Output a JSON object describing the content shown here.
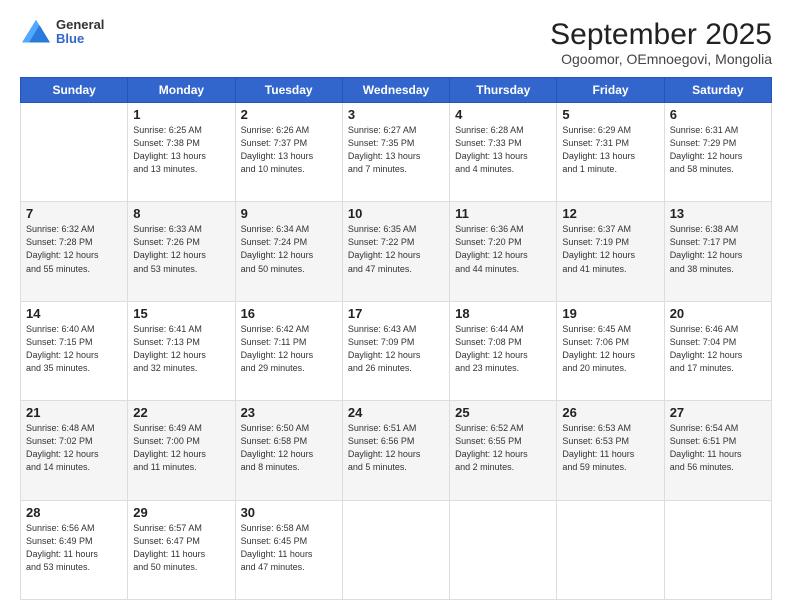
{
  "logo": {
    "general": "General",
    "blue": "Blue"
  },
  "title": {
    "month": "September 2025",
    "location": "Ogoomor, OEmnoegovi, Mongolia"
  },
  "weekdays": [
    "Sunday",
    "Monday",
    "Tuesday",
    "Wednesday",
    "Thursday",
    "Friday",
    "Saturday"
  ],
  "weeks": [
    [
      {
        "day": "",
        "text": ""
      },
      {
        "day": "1",
        "text": "Sunrise: 6:25 AM\nSunset: 7:38 PM\nDaylight: 13 hours\nand 13 minutes."
      },
      {
        "day": "2",
        "text": "Sunrise: 6:26 AM\nSunset: 7:37 PM\nDaylight: 13 hours\nand 10 minutes."
      },
      {
        "day": "3",
        "text": "Sunrise: 6:27 AM\nSunset: 7:35 PM\nDaylight: 13 hours\nand 7 minutes."
      },
      {
        "day": "4",
        "text": "Sunrise: 6:28 AM\nSunset: 7:33 PM\nDaylight: 13 hours\nand 4 minutes."
      },
      {
        "day": "5",
        "text": "Sunrise: 6:29 AM\nSunset: 7:31 PM\nDaylight: 13 hours\nand 1 minute."
      },
      {
        "day": "6",
        "text": "Sunrise: 6:31 AM\nSunset: 7:29 PM\nDaylight: 12 hours\nand 58 minutes."
      }
    ],
    [
      {
        "day": "7",
        "text": "Sunrise: 6:32 AM\nSunset: 7:28 PM\nDaylight: 12 hours\nand 55 minutes."
      },
      {
        "day": "8",
        "text": "Sunrise: 6:33 AM\nSunset: 7:26 PM\nDaylight: 12 hours\nand 53 minutes."
      },
      {
        "day": "9",
        "text": "Sunrise: 6:34 AM\nSunset: 7:24 PM\nDaylight: 12 hours\nand 50 minutes."
      },
      {
        "day": "10",
        "text": "Sunrise: 6:35 AM\nSunset: 7:22 PM\nDaylight: 12 hours\nand 47 minutes."
      },
      {
        "day": "11",
        "text": "Sunrise: 6:36 AM\nSunset: 7:20 PM\nDaylight: 12 hours\nand 44 minutes."
      },
      {
        "day": "12",
        "text": "Sunrise: 6:37 AM\nSunset: 7:19 PM\nDaylight: 12 hours\nand 41 minutes."
      },
      {
        "day": "13",
        "text": "Sunrise: 6:38 AM\nSunset: 7:17 PM\nDaylight: 12 hours\nand 38 minutes."
      }
    ],
    [
      {
        "day": "14",
        "text": "Sunrise: 6:40 AM\nSunset: 7:15 PM\nDaylight: 12 hours\nand 35 minutes."
      },
      {
        "day": "15",
        "text": "Sunrise: 6:41 AM\nSunset: 7:13 PM\nDaylight: 12 hours\nand 32 minutes."
      },
      {
        "day": "16",
        "text": "Sunrise: 6:42 AM\nSunset: 7:11 PM\nDaylight: 12 hours\nand 29 minutes."
      },
      {
        "day": "17",
        "text": "Sunrise: 6:43 AM\nSunset: 7:09 PM\nDaylight: 12 hours\nand 26 minutes."
      },
      {
        "day": "18",
        "text": "Sunrise: 6:44 AM\nSunset: 7:08 PM\nDaylight: 12 hours\nand 23 minutes."
      },
      {
        "day": "19",
        "text": "Sunrise: 6:45 AM\nSunset: 7:06 PM\nDaylight: 12 hours\nand 20 minutes."
      },
      {
        "day": "20",
        "text": "Sunrise: 6:46 AM\nSunset: 7:04 PM\nDaylight: 12 hours\nand 17 minutes."
      }
    ],
    [
      {
        "day": "21",
        "text": "Sunrise: 6:48 AM\nSunset: 7:02 PM\nDaylight: 12 hours\nand 14 minutes."
      },
      {
        "day": "22",
        "text": "Sunrise: 6:49 AM\nSunset: 7:00 PM\nDaylight: 12 hours\nand 11 minutes."
      },
      {
        "day": "23",
        "text": "Sunrise: 6:50 AM\nSunset: 6:58 PM\nDaylight: 12 hours\nand 8 minutes."
      },
      {
        "day": "24",
        "text": "Sunrise: 6:51 AM\nSunset: 6:56 PM\nDaylight: 12 hours\nand 5 minutes."
      },
      {
        "day": "25",
        "text": "Sunrise: 6:52 AM\nSunset: 6:55 PM\nDaylight: 12 hours\nand 2 minutes."
      },
      {
        "day": "26",
        "text": "Sunrise: 6:53 AM\nSunset: 6:53 PM\nDaylight: 11 hours\nand 59 minutes."
      },
      {
        "day": "27",
        "text": "Sunrise: 6:54 AM\nSunset: 6:51 PM\nDaylight: 11 hours\nand 56 minutes."
      }
    ],
    [
      {
        "day": "28",
        "text": "Sunrise: 6:56 AM\nSunset: 6:49 PM\nDaylight: 11 hours\nand 53 minutes."
      },
      {
        "day": "29",
        "text": "Sunrise: 6:57 AM\nSunset: 6:47 PM\nDaylight: 11 hours\nand 50 minutes."
      },
      {
        "day": "30",
        "text": "Sunrise: 6:58 AM\nSunset: 6:45 PM\nDaylight: 11 hours\nand 47 minutes."
      },
      {
        "day": "",
        "text": ""
      },
      {
        "day": "",
        "text": ""
      },
      {
        "day": "",
        "text": ""
      },
      {
        "day": "",
        "text": ""
      }
    ]
  ]
}
